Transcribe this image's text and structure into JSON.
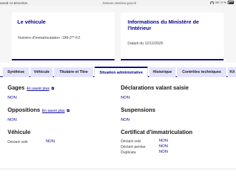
{
  "status_bar": {
    "time": "amedi 13 décembre",
    "url": "histovec.interieur.gouv.fr",
    "network": "5G",
    "battery": "0 %"
  },
  "cards": {
    "vehicle": {
      "title": "Le véhicule",
      "registration": "Numéro d'immatriculation : DM-2**-FZ"
    },
    "ministry": {
      "title": "Informations du Ministère de l'Intérieur",
      "date": "Datant du 12/12/2025"
    }
  },
  "tabs": [
    {
      "label": "Synthèse"
    },
    {
      "label": "Véhicule"
    },
    {
      "label": "Titulaire et Titre"
    },
    {
      "label": "Situation administrative",
      "active": true
    },
    {
      "label": "Historique"
    },
    {
      "label": "Contrôles techniques"
    },
    {
      "label": "Kil"
    }
  ],
  "sections": {
    "gages": {
      "title": "Gages",
      "more": "En savoir plus",
      "value": "NON"
    },
    "declarations": {
      "title": "Déclarations valant saisie",
      "value": "NON"
    },
    "oppositions": {
      "title": "Oppositions",
      "more": "En savoir plus",
      "value": "NON"
    },
    "suspensions": {
      "title": "Suspensions",
      "value": "NON"
    },
    "vehicule": {
      "title": "Véhicule",
      "rows": [
        {
          "label": "Déclaré volé",
          "value": "NON"
        }
      ]
    },
    "certificat": {
      "title": "Certificat d'immatriculation",
      "rows": [
        {
          "label": "Déclaré volé",
          "value": "NON"
        },
        {
          "label": "Déclaré perdue",
          "value": "NON"
        },
        {
          "label": "Duplicata",
          "value": "NON"
        }
      ]
    }
  },
  "icons": {
    "external_link": "external-link-icon"
  },
  "colors": {
    "accent": "#000091",
    "tab_bg": "#e3e3fd",
    "top_bg": "#f6f6f6"
  }
}
